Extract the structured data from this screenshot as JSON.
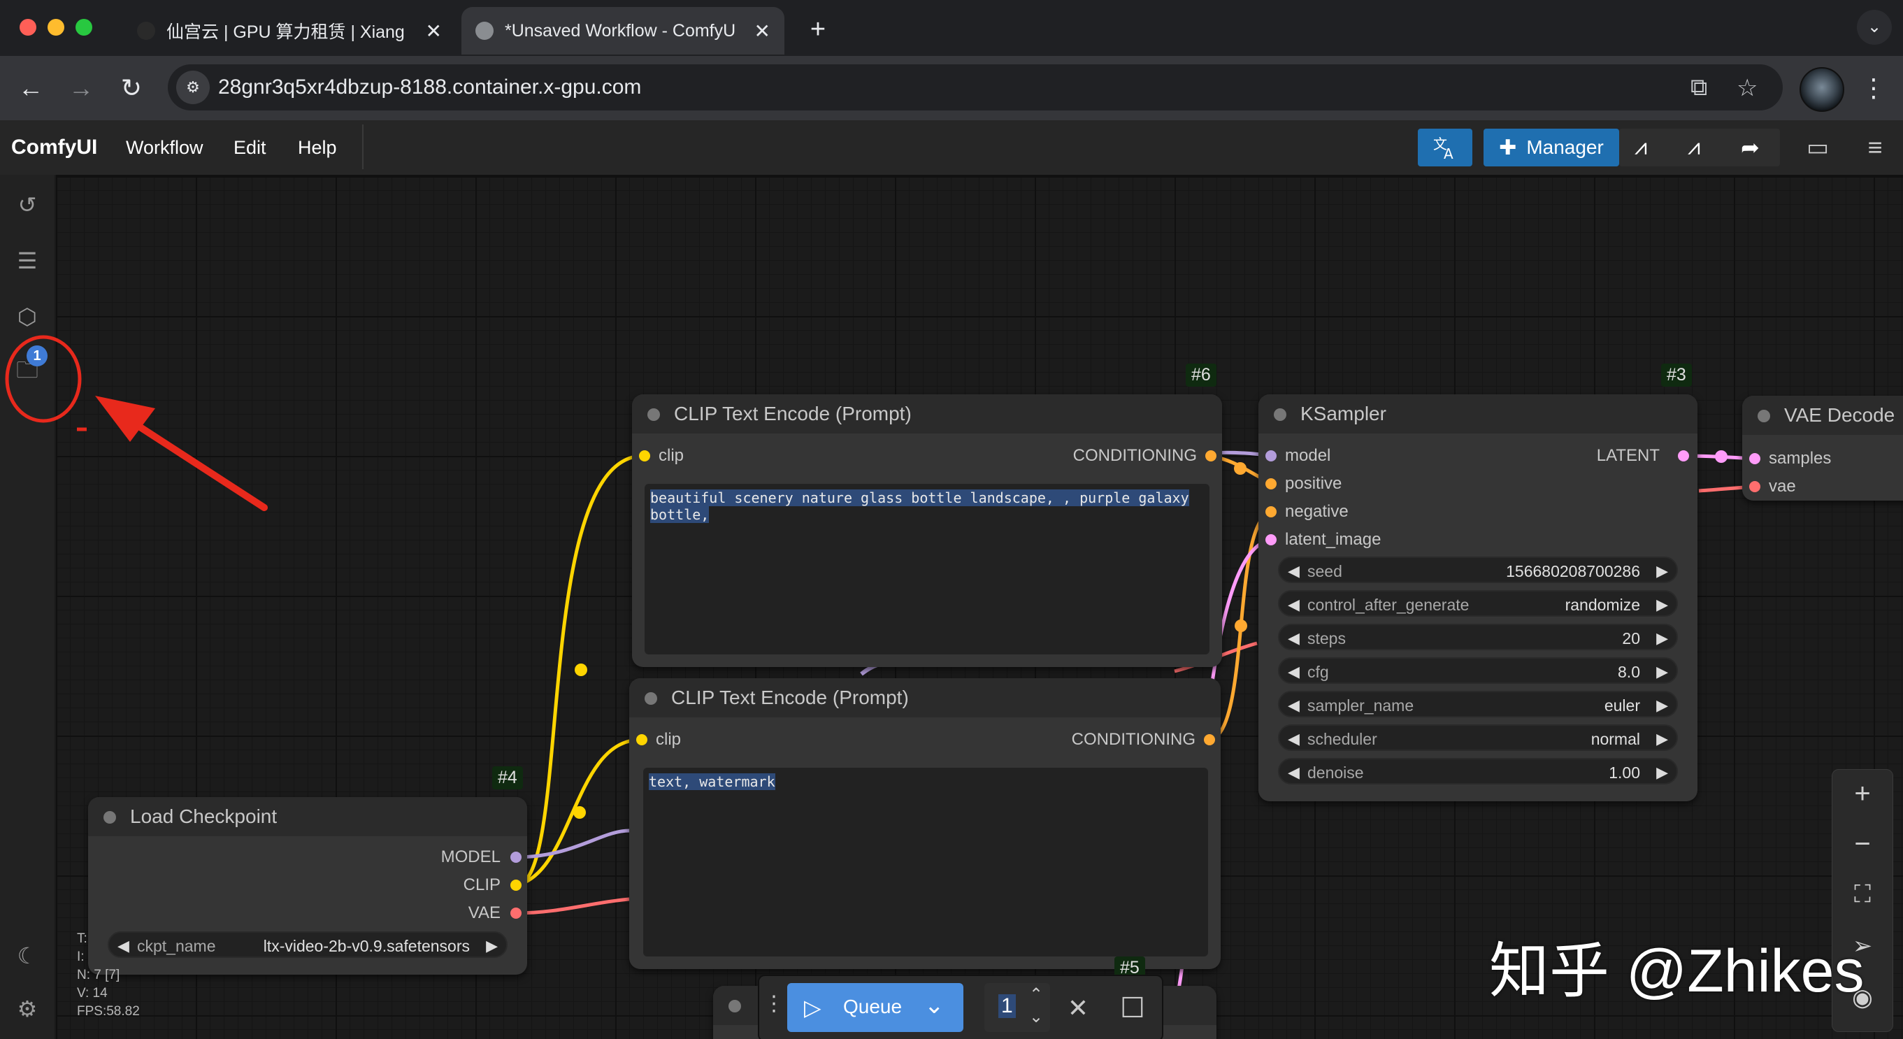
{
  "browser": {
    "tabs": [
      {
        "title": "仙宫云 | GPU 算力租赁 | Xiang",
        "active": false
      },
      {
        "title": "*Unsaved Workflow - ComfyU",
        "active": true
      }
    ],
    "url": "28gnr3q5xr4dbzup-8188.container.x-gpu.com"
  },
  "menu": {
    "logo": "ComfyUI",
    "items": [
      "Workflow",
      "Edit",
      "Help"
    ],
    "manager_label": "Manager"
  },
  "sidebar": {
    "badge": "1",
    "icons": [
      "history-icon",
      "queue-list-icon",
      "model-library-icon",
      "workflows-folder-icon",
      "theme-moon-icon",
      "settings-gear-icon"
    ]
  },
  "nodes": {
    "clip6": {
      "id": "#6",
      "title": "CLIP Text Encode (Prompt)",
      "input": "clip",
      "output": "CONDITIONING",
      "text": "beautiful scenery nature glass bottle landscape, , purple galaxy bottle,"
    },
    "clip7": {
      "title": "CLIP Text Encode (Prompt)",
      "input": "clip",
      "output": "CONDITIONING",
      "text": "text, watermark"
    },
    "ksampler": {
      "id": "#3",
      "title": "KSampler",
      "inputs": [
        "model",
        "positive",
        "negative",
        "latent_image"
      ],
      "output": "LATENT",
      "widgets": [
        {
          "label": "seed",
          "value": "156680208700286"
        },
        {
          "label": "control_after_generate",
          "value": "randomize"
        },
        {
          "label": "steps",
          "value": "20"
        },
        {
          "label": "cfg",
          "value": "8.0"
        },
        {
          "label": "sampler_name",
          "value": "euler"
        },
        {
          "label": "scheduler",
          "value": "normal"
        },
        {
          "label": "denoise",
          "value": "1.00"
        }
      ]
    },
    "vae": {
      "title": "VAE Decode",
      "inputs": [
        "samples",
        "vae"
      ]
    },
    "ckpt": {
      "id": "#4",
      "title": "Load Checkpoint",
      "outputs": [
        "MODEL",
        "CLIP",
        "VAE"
      ],
      "widget_label": "ckpt_name",
      "widget_value": "ltx-video-2b-v0.9.safetensors"
    },
    "latent_id": "#5"
  },
  "queue": {
    "label": "Queue",
    "count": "1"
  },
  "stats": {
    "lines": [
      "T:",
      "I:",
      "N: 7 [7]",
      "V: 14",
      "FPS:58.82"
    ]
  },
  "watermark": "知乎 @Zhikes",
  "colors": {
    "clip": "#ffd500",
    "model": "#b39ddb",
    "conditioning": "#ffa931",
    "latent": "#ff9cf9",
    "vae": "#ff6e6e",
    "annotation": "#e8291c",
    "accent": "#1f6fb0"
  }
}
